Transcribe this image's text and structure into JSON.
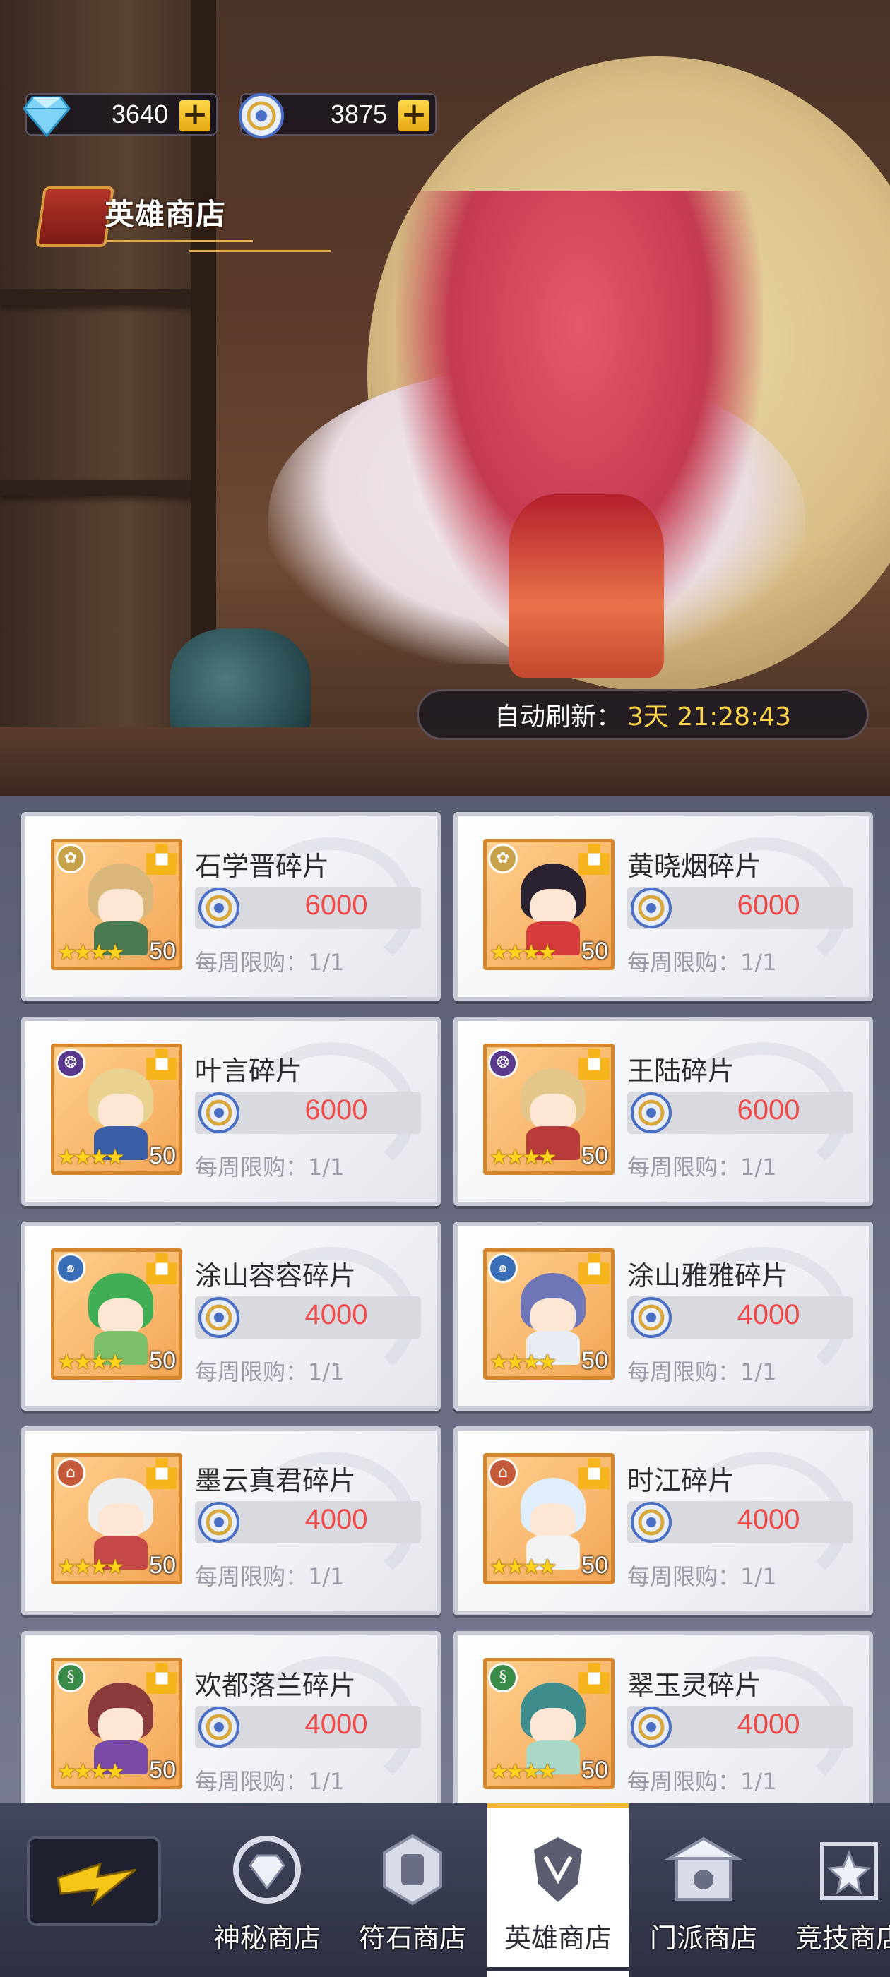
{
  "currency": [
    {
      "icon": "diamond-icon",
      "value": "3640"
    },
    {
      "icon": "coin-icon",
      "value": "3875"
    }
  ],
  "shop_title": "英雄商店",
  "refresh": {
    "label": "自动刷新：",
    "time": "3天 21:28:43"
  },
  "items": [
    {
      "name": "石学晋碎片",
      "price": "6000",
      "limit": "每周限购：1/1",
      "count": "50",
      "faction_icon": "lotus-icon",
      "faction_color": "#c8a24a",
      "hair": "#d9b77a",
      "outfit": "#4b7b52"
    },
    {
      "name": "黄晓烟碎片",
      "price": "6000",
      "limit": "每周限购：1/1",
      "count": "50",
      "faction_icon": "lotus-icon",
      "faction_color": "#c8a24a",
      "hair": "#2a2230",
      "outfit": "#d63b3b"
    },
    {
      "name": "叶言碎片",
      "price": "6000",
      "limit": "每周限购：1/1",
      "count": "50",
      "faction_icon": "flame-icon",
      "faction_color": "#5a3a8c",
      "hair": "#e9d28f",
      "outfit": "#3a5fa8"
    },
    {
      "name": "王陆碎片",
      "price": "6000",
      "limit": "每周限购：1/1",
      "count": "50",
      "faction_icon": "flame-icon",
      "faction_color": "#5a3a8c",
      "hair": "#e4c68a",
      "outfit": "#b83a3a"
    },
    {
      "name": "涂山容容碎片",
      "price": "4000",
      "limit": "每周限购：1/1",
      "count": "50",
      "faction_icon": "swirl-icon",
      "faction_color": "#3a6fb8",
      "hair": "#3fae55",
      "outfit": "#7bbf6a"
    },
    {
      "name": "涂山雅雅碎片",
      "price": "4000",
      "limit": "每周限购：1/1",
      "count": "50",
      "faction_icon": "swirl-icon",
      "faction_color": "#3a6fb8",
      "hair": "#6f76b8",
      "outfit": "#e8ecf3"
    },
    {
      "name": "墨云真君碎片",
      "price": "4000",
      "limit": "每周限购：1/1",
      "count": "50",
      "faction_icon": "temple-icon",
      "faction_color": "#c45a3a",
      "hair": "#eeeeee",
      "outfit": "#c44848"
    },
    {
      "name": "时江碎片",
      "price": "4000",
      "limit": "每周限购：1/1",
      "count": "50",
      "faction_icon": "temple-icon",
      "faction_color": "#c45a3a",
      "hair": "#dfeefa",
      "outfit": "#f2f2f2"
    },
    {
      "name": "欢都落兰碎片",
      "price": "4000",
      "limit": "每周限购：1/1",
      "count": "50",
      "faction_icon": "dna-icon",
      "faction_color": "#3a8a4a",
      "hair": "#8a3a3a",
      "outfit": "#7a4aa8"
    },
    {
      "name": "翠玉灵碎片",
      "price": "4000",
      "limit": "每周限购：1/1",
      "count": "50",
      "faction_icon": "dna-icon",
      "faction_color": "#3a8a4a",
      "hair": "#3f8c8c",
      "outfit": "#a8d8c8"
    }
  ],
  "nav": {
    "back_icon": "lightning-back-icon",
    "tabs": [
      {
        "label": "神秘商店",
        "icon": "diamond-emblem-icon",
        "active": false
      },
      {
        "label": "符石商店",
        "icon": "rune-stone-icon",
        "active": false
      },
      {
        "label": "英雄商店",
        "icon": "hero-crest-icon",
        "active": true
      },
      {
        "label": "门派商店",
        "icon": "gate-icon",
        "active": false
      },
      {
        "label": "竞技商店",
        "icon": "arena-icon",
        "active": false
      }
    ]
  },
  "colors": {
    "price": "#ef4a4a",
    "refresh_time": "#ffd54a",
    "accent": "#f5b732"
  }
}
